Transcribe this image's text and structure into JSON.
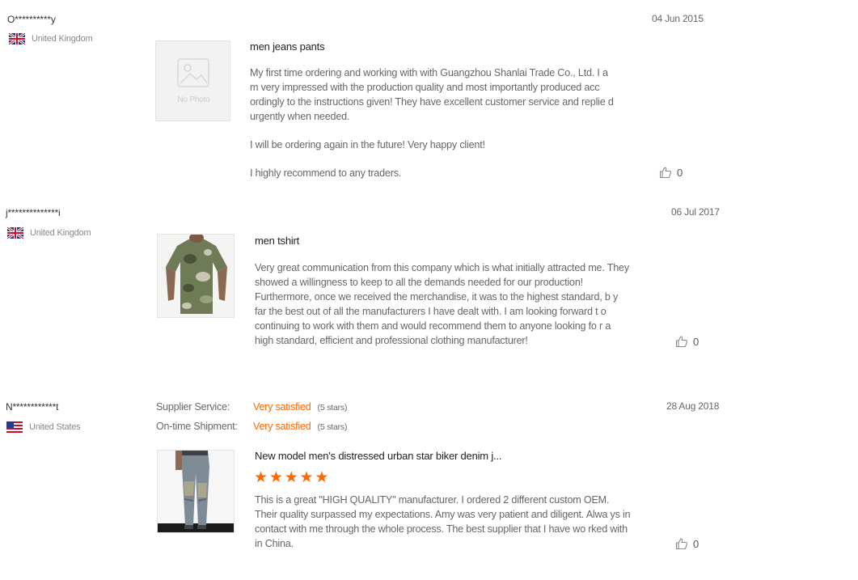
{
  "reviews": [
    {
      "username": "O**********y",
      "country": "United Kingdom",
      "flag": "uk",
      "date": "04 Jun 2015",
      "thumbnail_placeholder": "No Photo",
      "product_title": "men jeans pants",
      "paragraphs": [
        "My first time ordering and working with with Guangzhou Shanlai Trade Co., Ltd. I a m very impressed with the production quality and most importantly produced acc ordingly to the instructions given! They have excellent customer service and replie d urgently when needed.",
        "I will be ordering again in the future! Very happy client!",
        "I highly recommend to any traders."
      ],
      "likes": "0"
    },
    {
      "username": "j**************i",
      "country": "United Kingdom",
      "flag": "uk",
      "date": "06 Jul 2017",
      "product_title": "men tshirt",
      "paragraphs": [
        "Very great communication from this company which is what initially attracted me. They showed a willingness to keep to all the demands needed for our production! Furthermore, once we received the merchandise, it was to the highest standard, b y far the best out of all the manufacturers I have dealt with. I am looking forward t o continuing to work with them and would recommend them to anyone looking fo r a high standard, efficient and professional clothing manufacturer!"
      ],
      "likes": "0"
    },
    {
      "username": "N************t",
      "country": "United States",
      "flag": "us",
      "date": "28 Aug 2018",
      "ratings": [
        {
          "label": "Supplier Service:",
          "value": "Very satisfied",
          "stars": "(5 stars)"
        },
        {
          "label": "On-time Shipment:",
          "value": "Very satisfied",
          "stars": "(5 stars)"
        }
      ],
      "product_title": "New model men's distressed urban star biker denim j...",
      "star_rating": 5,
      "star_glyph": "★",
      "paragraphs": [
        "This is a great \"HIGH QUALITY\" manufacturer. I ordered 2 different custom OEM. Their quality surpassed my expectations. Amy was very patient and diligent. Alwa ys in contact with me through the whole process. The best supplier that I have wo rked with in China."
      ],
      "likes": "0"
    }
  ],
  "colors": {
    "accent": "#ff6600",
    "star": "#ff6a00",
    "text": "#666666",
    "title": "#222222"
  }
}
